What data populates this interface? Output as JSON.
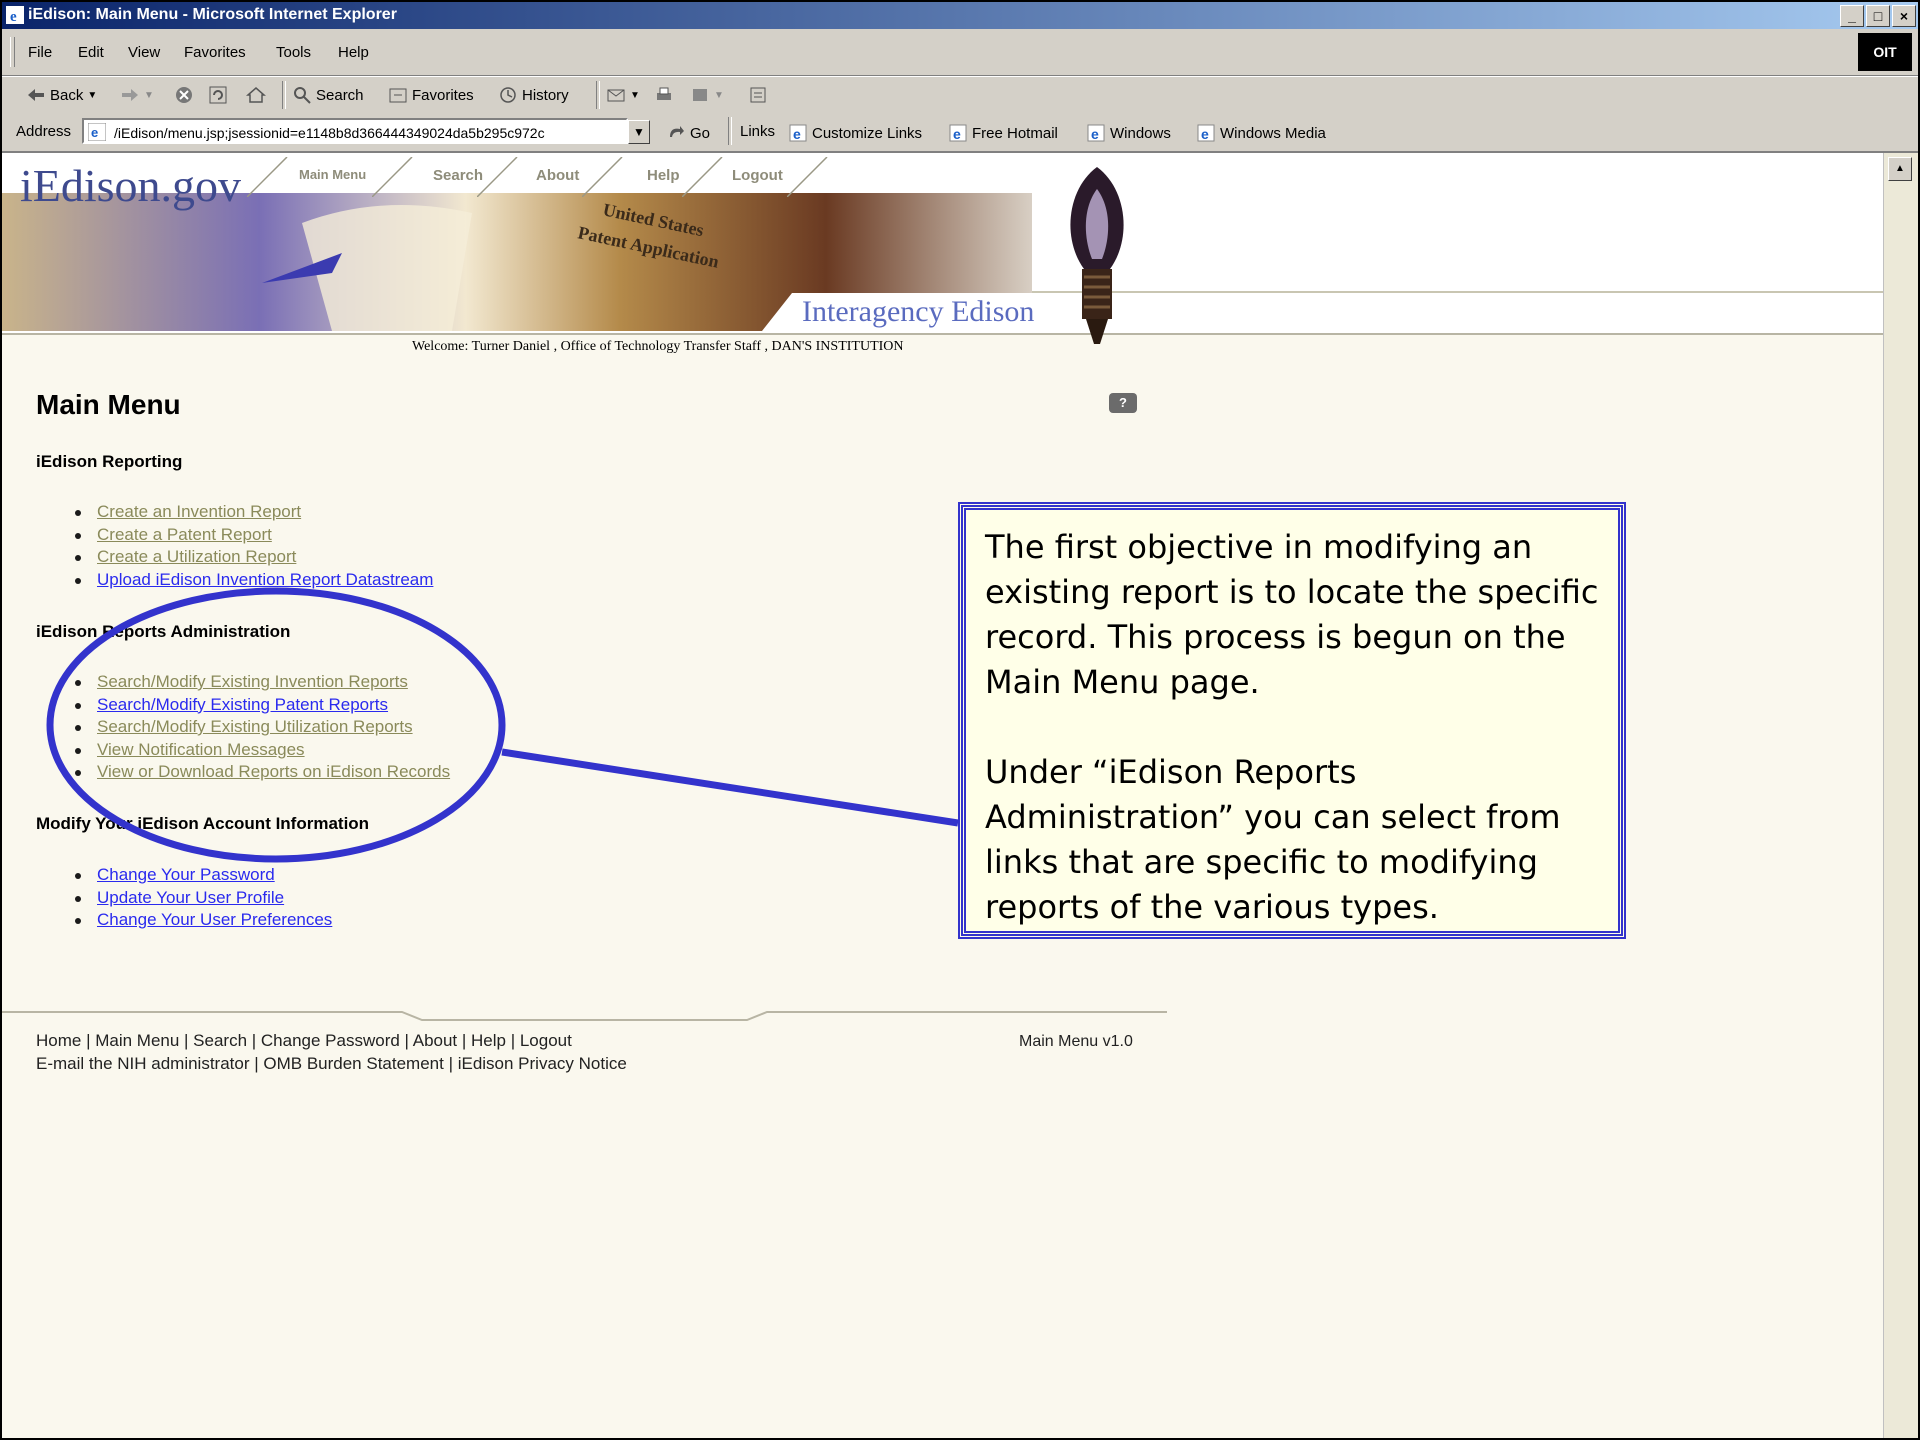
{
  "window": {
    "title": "iEdison: Main Menu - Microsoft Internet Explorer",
    "controls": [
      "_",
      "□",
      "×"
    ]
  },
  "menubar": {
    "items": [
      "File",
      "Edit",
      "View",
      "Favorites",
      "Tools",
      "Help"
    ],
    "logo": "OIT"
  },
  "toolbar": {
    "back": "Back",
    "search": "Search",
    "favorites": "Favorites",
    "history": "History"
  },
  "addressbar": {
    "label": "Address",
    "url": "/iEdison/menu.jsp;jsessionid=e1148b8d366444349024da5b295c972c",
    "go": "Go",
    "links_label": "Links",
    "links": [
      "Customize Links",
      "Free Hotmail",
      "Windows",
      "Windows Media"
    ]
  },
  "site": {
    "logo": "iEdison.gov",
    "nav": [
      "Main Menu",
      "Search",
      "About",
      "Help",
      "Logout"
    ],
    "tagline": "Interagency Edison",
    "collage_text_1": "United States",
    "collage_text_2": "Patent Application",
    "welcome": "Welcome: Turner Daniel , Office of Technology Transfer Staff , DAN'S INSTITUTION"
  },
  "main": {
    "title": "Main Menu",
    "help_icon": "?",
    "sections": [
      {
        "heading": "iEdison Reporting",
        "links": [
          {
            "label": "Create an Invention Report",
            "visited": true
          },
          {
            "label": "Create a Patent Report",
            "visited": true
          },
          {
            "label": "Create a Utilization Report",
            "visited": true
          },
          {
            "label": "Upload iEdison Invention Report Datastream",
            "visited": false
          }
        ]
      },
      {
        "heading": "iEdison Reports Administration",
        "links": [
          {
            "label": "Search/Modify Existing Invention Reports",
            "visited": true
          },
          {
            "label": "Search/Modify Existing Patent Reports",
            "visited": false
          },
          {
            "label": "Search/Modify Existing Utilization Reports",
            "visited": true
          },
          {
            "label": "View Notification Messages",
            "visited": true
          },
          {
            "label": "View or Download Reports on iEdison Records",
            "visited": true
          }
        ]
      },
      {
        "heading": "Modify Your iEdison Account Information",
        "links": [
          {
            "label": "Change Your Password",
            "visited": false
          },
          {
            "label": "Update Your User Profile",
            "visited": false
          },
          {
            "label": "Change Your User Preferences",
            "visited": false
          }
        ]
      }
    ]
  },
  "footer": {
    "line1": "Home | Main Menu | Search | Change Password | About | Help | Logout",
    "line2": "E-mail the NIH administrator | OMB Burden Statement | iEdison Privacy Notice",
    "version": "Main Menu v1.0"
  },
  "callout": {
    "para1": "The first objective in modifying an existing report is to locate the specific record.  This process is begun on the Main Menu page.",
    "para2": "Under “iEdison Reports Administration” you can select from links that are specific to modifying reports of the various types."
  },
  "colors": {
    "visited_link": "#8a8a5a",
    "unvisited_link": "#2a2aee",
    "annotation": "#3333cc",
    "page_bg": "#faf8ee"
  }
}
